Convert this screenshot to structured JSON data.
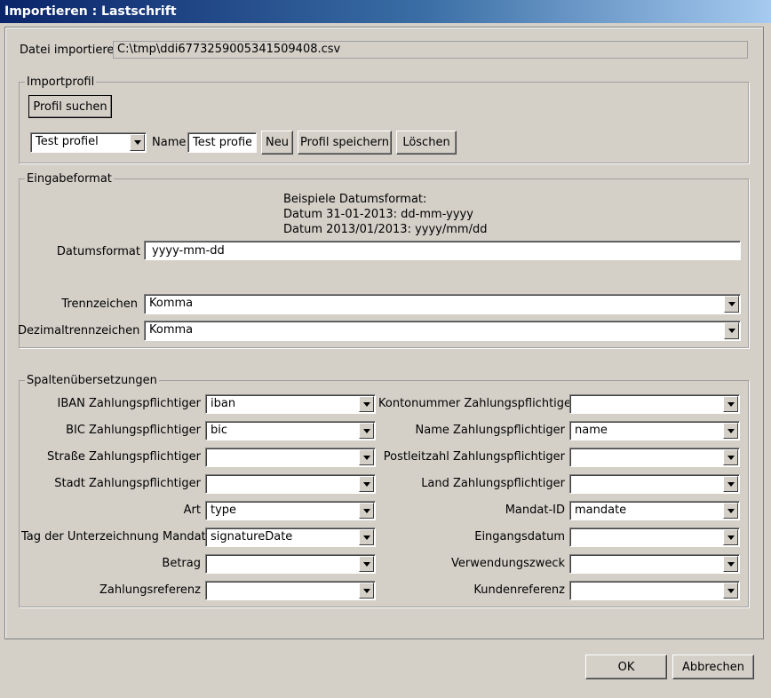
{
  "window": {
    "title": "Importieren : Lastschrift"
  },
  "file": {
    "label": "Datei importieren",
    "path": "C:\\tmp\\ddi6773259005341509408.csv"
  },
  "profile": {
    "legend": "Importprofil",
    "search_label": "Profil suchen",
    "selected": "Test profiel",
    "name_label": "Name",
    "name_value": "Test profiel",
    "new_label": "Neu",
    "save_label": "Profil speichern",
    "delete_label": "Löschen"
  },
  "format": {
    "legend": "Eingabeformat",
    "examples": [
      "Beispiele Datumsformat:",
      "Datum 31-01-2013: dd-mm-yyyy",
      "Datum 2013/01/2013: yyyy/mm/dd"
    ],
    "date_label": "Datumsformat",
    "date_value": "yyyy-mm-dd",
    "sep_label": "Trennzeichen",
    "sep_value": "Komma",
    "dec_label": "Dezimaltrennzeichen",
    "dec_value": "Komma"
  },
  "columns": {
    "legend": "Spaltenübersetzungen",
    "left": [
      {
        "label": "IBAN Zahlungspflichtiger",
        "value": "iban"
      },
      {
        "label": "BIC Zahlungspflichtiger",
        "value": "bic"
      },
      {
        "label": "Straße Zahlungspflichtiger",
        "value": ""
      },
      {
        "label": "Stadt Zahlungspflichtiger",
        "value": ""
      },
      {
        "label": "Art",
        "value": "type"
      },
      {
        "label": "Tag der Unterzeichnung Mandat",
        "value": "signatureDate"
      },
      {
        "label": "Betrag",
        "value": ""
      },
      {
        "label": "Zahlungsreferenz",
        "value": ""
      }
    ],
    "right": [
      {
        "label": "Kontonummer Zahlungspflichtiger",
        "value": ""
      },
      {
        "label": "Name Zahlungspflichtiger",
        "value": "name"
      },
      {
        "label": "Postleitzahl Zahlungspflichtiger",
        "value": ""
      },
      {
        "label": "Land Zahlungspflichtiger",
        "value": ""
      },
      {
        "label": "Mandat-ID",
        "value": "mandate"
      },
      {
        "label": "Eingangsdatum",
        "value": ""
      },
      {
        "label": "Verwendungszweck",
        "value": ""
      },
      {
        "label": "Kundenreferenz",
        "value": ""
      }
    ]
  },
  "footer": {
    "ok_label": "OK",
    "cancel_label": "Abbrechen"
  }
}
